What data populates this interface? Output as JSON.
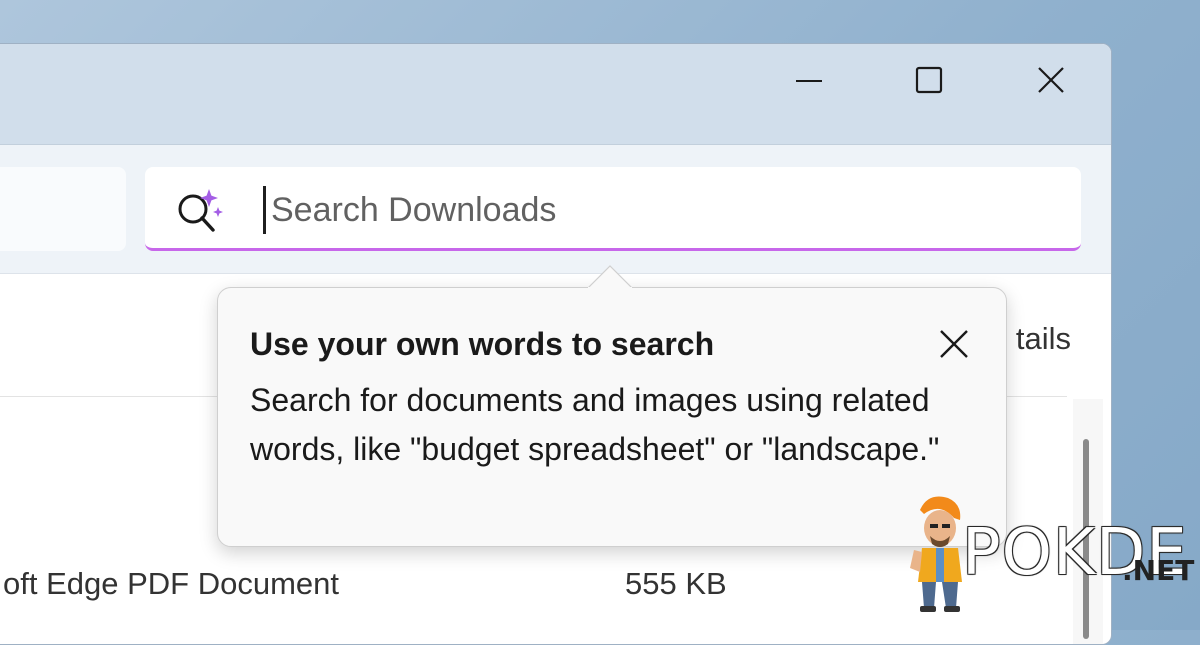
{
  "search": {
    "placeholder": "Search Downloads"
  },
  "toolbar": {
    "details_label": "tails"
  },
  "tooltip": {
    "title": "Use your own words to search",
    "body": "Search for documents and images using related words, like \"budget spreadsheet\" or \"landscape.\""
  },
  "file_row": {
    "type": "oft Edge PDF Document",
    "size": "555 KB"
  },
  "watermark": {
    "brand": "POKDE",
    "suffix": ".NET"
  },
  "colors": {
    "search_accent": "#c767ea",
    "sparkle": "#a45ee5",
    "titlebar": "#d1deeb",
    "toolbar": "#eef3f8"
  },
  "icons": {
    "search": "ai-search-icon",
    "minimize": "minimize-icon",
    "maximize": "maximize-icon",
    "close": "close-icon",
    "tooltip_close": "close-icon"
  }
}
